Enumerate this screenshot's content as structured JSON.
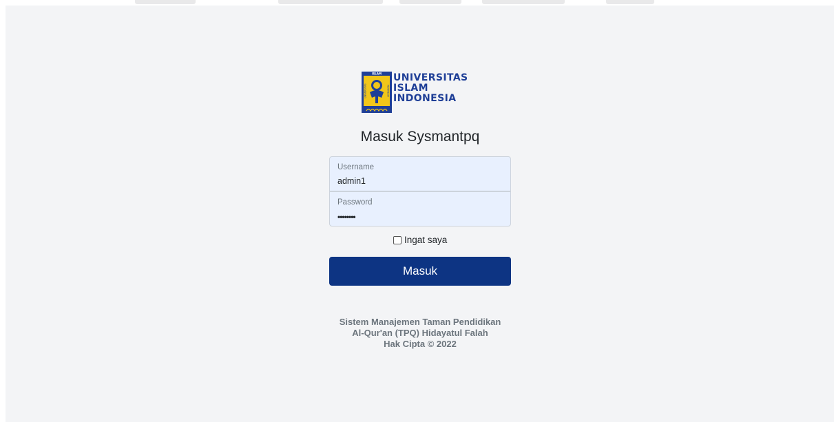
{
  "logo": {
    "lines": [
      "UNIVERSITAS",
      "ISLAM",
      "INDONESIA"
    ],
    "emblem_texts": [
      "ISLAM",
      "UNIVERSITAS",
      "INDONESIA"
    ],
    "brand_color": "#1f3f97",
    "emblem_yellow": "#f2c619"
  },
  "login": {
    "title": "Masuk Sysmantpq",
    "username_label": "Username",
    "username_value": "admin1",
    "password_label": "Password",
    "password_mask": "••••••••",
    "remember_label": "Ingat saya",
    "remember_checked": false,
    "submit_label": "Masuk",
    "button_color": "#0d3483"
  },
  "footer": {
    "line1": "Sistem Manajemen Taman Pendidikan",
    "line2": "Al-Qur'an (TPQ) Hidayatul Falah",
    "line3": "Hak Cipta © 2022"
  }
}
